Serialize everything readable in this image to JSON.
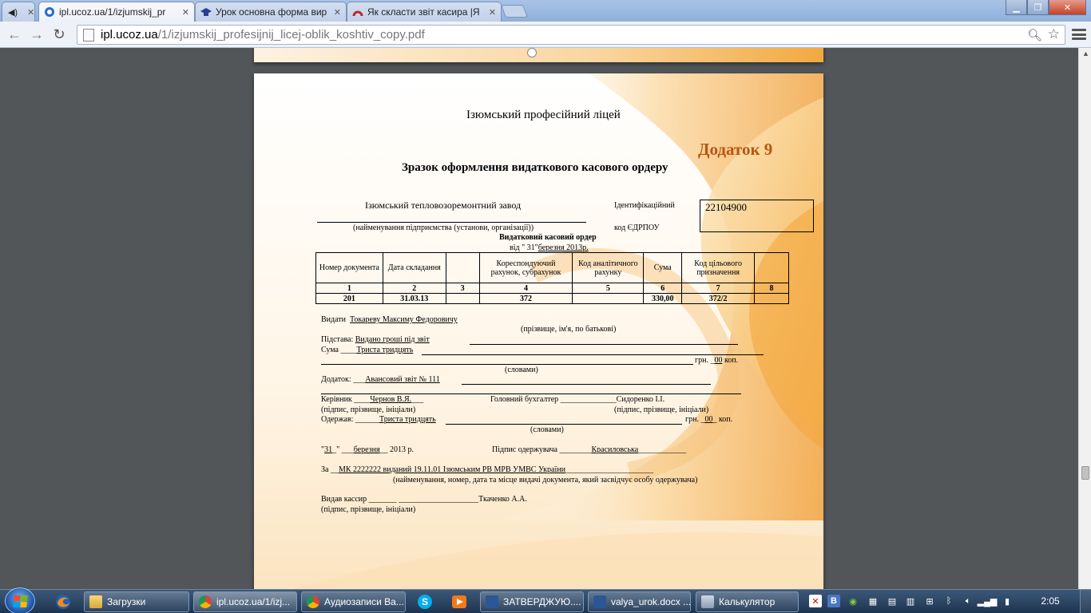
{
  "browser": {
    "tabs": [
      {
        "title": "",
        "favicon": "speaker-icon",
        "active": false
      },
      {
        "title": "ipl.ucoz.ua/1/izjumskij_pr",
        "favicon": "ucoz-icon",
        "active": true
      },
      {
        "title": "Урок основна форма вир",
        "favicon": "graduation-cap-icon",
        "active": false
      },
      {
        "title": "Як скласти звіт касира |Я",
        "favicon": "site-icon",
        "active": false
      }
    ],
    "url_host": "ipl.ucoz.ua",
    "url_path": "/1/izjumskij_profesijnij_licej-oblik_koshtiv_copy.pdf"
  },
  "document": {
    "institution": "Ізюмський професійний ліцей",
    "appendix": "Додаток 9",
    "doc_title": "Зразок оформлення видаткового касового ордеру",
    "enterprise_name": "Ізюмський тепловозоремонтний завод",
    "enterprise_caption": "(найменування підприємства (установи, організації))",
    "id_label": "Ідентифікаційний",
    "edrpou_label": "код ЄДРПОУ",
    "edrpou_value": "22104900",
    "order_title": "Видатковий касовий ордер",
    "order_date_prefix": "від \" 31\"",
    "order_date_value": "березня 2013р.",
    "table": {
      "headers": [
        "Номер документа",
        "Дата складання",
        "",
        "Кореспондуючий рахунок, субрахунок",
        "Код аналітичного рахунку",
        "Сума",
        "Код цільового призначення",
        ""
      ],
      "numbers": [
        "1",
        "2",
        "3",
        "4",
        "5",
        "6",
        "7",
        "8"
      ],
      "values": [
        "201",
        "31.03.13",
        "",
        "372",
        "",
        "330,00",
        "372/2",
        ""
      ]
    },
    "issue_label": "Видати",
    "issue_value": "Токареву Максиму Федоровичу",
    "issue_caption": "(прізвище, ім'я, по батькові)",
    "basis_label": "Підстава:",
    "basis_value": "Видано гроші під звіт",
    "sum_label": "Сума",
    "sum_value": "Триста тридцять",
    "sum_uah_label": "грн.",
    "sum_kop_value": "00",
    "sum_kop_label": "коп.",
    "words_caption": "(словами)",
    "attach_label": "Додаток:",
    "attach_value": "Авансовий звіт № 111",
    "head_label": "Керівник",
    "head_value": "Чернов В.Я.",
    "chief_acc_label": "Головний бухгалтер",
    "chief_acc_value": "Сидоренко І.І.",
    "sig_caption": "(підпис, прізвище, ініціали)",
    "received_label": "Одержав:",
    "received_value": "Триста тридцять",
    "received_uah": "грн.",
    "received_kop": "00",
    "received_kop_label": "коп.",
    "date_day": "31",
    "date_month": "березня",
    "date_year": "2013 р.",
    "recipient_sig_label": "Підпис одержувача",
    "recipient_sig_value": "Красиловська",
    "passport_label": "За",
    "passport_value": "МК 2222222  виданий 19.11.01 Ізюмським РВ МРВ УМВС України",
    "passport_caption": "(найменування, номер, дата та місце видачі документа, який засвідчує особу одержувача)",
    "cashier_label": "Видав кассир",
    "cashier_value": "Ткаченко А.А.",
    "cashier_caption": "(підпис, прізвище, ініціали)"
  },
  "taskbar": {
    "pinned": [
      "firefox-icon"
    ],
    "buttons": [
      {
        "label": "Загрузки",
        "icon": "folder-icon",
        "active": false
      },
      {
        "label": "ipl.ucoz.ua/1/izj...",
        "icon": "chrome-icon",
        "active": true
      },
      {
        "label": "Аудиозаписи Ва...",
        "icon": "chrome-icon",
        "active": false
      },
      {
        "label": "ЗАТВЕРДЖУЮ....",
        "icon": "word-icon",
        "active": false
      },
      {
        "label": "valya_urok.docx ...",
        "icon": "word-icon",
        "active": false
      },
      {
        "label": "Калькулятор",
        "icon": "calculator-icon",
        "active": false
      }
    ],
    "clock": "2:05"
  },
  "colors": {
    "appendix": "#b8560f",
    "accent": "#f2a93f"
  }
}
